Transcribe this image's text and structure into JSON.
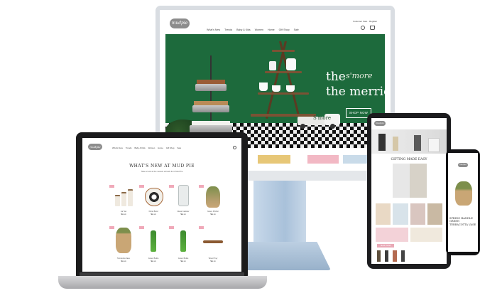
{
  "brand": "mudpie",
  "desktop": {
    "nav": [
      "What's New",
      "Trends",
      "Baby & Kids",
      "Women",
      "Home",
      "Gift Shop",
      "Sale"
    ],
    "util": "Customer Care · Register",
    "hero": {
      "line1": "the",
      "script": "s'more",
      "line2": "the merrier",
      "button": "SHOP NOW",
      "sign": "S'more"
    }
  },
  "laptop": {
    "nav": [
      "What's New",
      "Trends",
      "Baby & Kids",
      "Women",
      "Home",
      "Gift Shop",
      "Sale"
    ],
    "heading": "WHAT'S NEW AT MUD PIE",
    "subheading": "Take a look at the newest arrivals from Mud Pie",
    "products": [
      {
        "name": "Jar Set",
        "price": "$xx.xx",
        "badge": "NEW"
      },
      {
        "name": "Floral Bowl",
        "price": "$xx.xx",
        "badge": "NEW"
      },
      {
        "name": "Glass Canister",
        "price": "$xx.xx",
        "badge": "NEW"
      },
      {
        "name": "Green Pitcher",
        "price": "$xx.xx",
        "badge": "NEW"
      },
      {
        "name": "Terracotta Vase",
        "price": "$xx.xx",
        "badge": "NEW"
      },
      {
        "name": "Green Bottle",
        "price": "$xx.xx",
        "badge": "NEW"
      },
      {
        "name": "Green Bottle",
        "price": "$xx.xx",
        "badge": "NEW"
      },
      {
        "name": "Wood Tray",
        "price": "$xx.xx",
        "badge": "NEW"
      }
    ]
  },
  "tablet": {
    "banner": "GIFTING MADE EASY",
    "button": "SHOP NOW"
  },
  "phone": {
    "caption": "SPRING HANDLE GREEN TERRACOTTA VASE"
  },
  "colors": {
    "hero_green": "#1d6a3c",
    "badge_pink": "#f0a9b9",
    "frame_dark": "#1b1b1c",
    "stand_blue": "#a9c1da"
  }
}
